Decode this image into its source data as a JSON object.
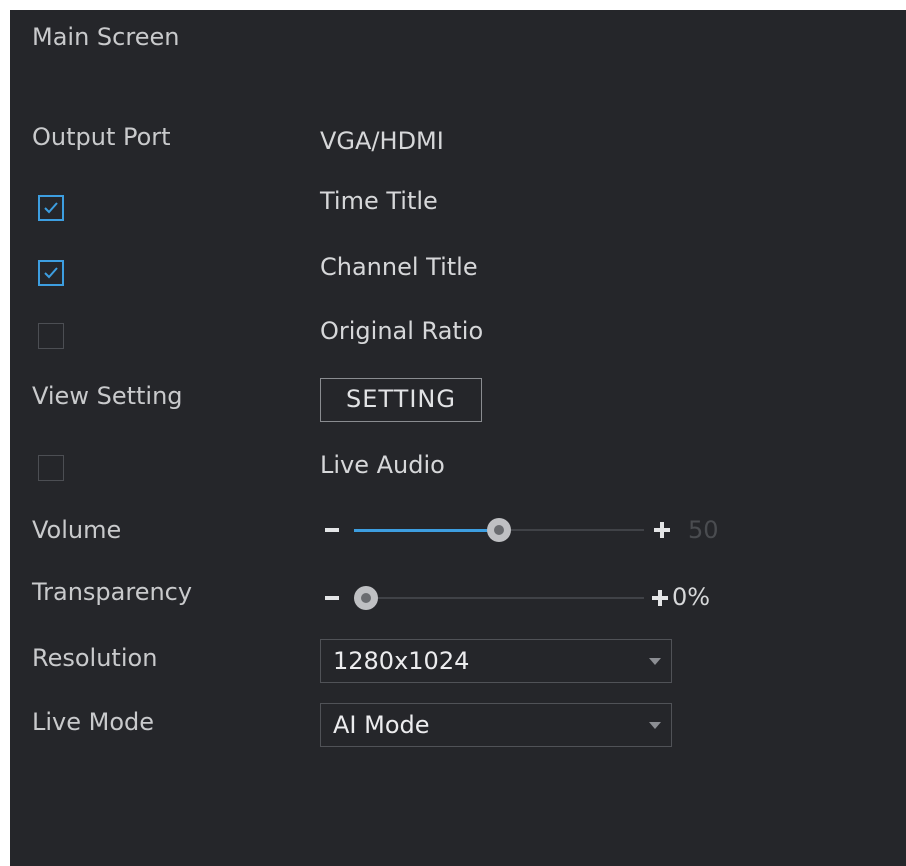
{
  "section_title": "Main Screen",
  "output_port": {
    "label": "Output Port",
    "value": "VGA/HDMI"
  },
  "time_title": {
    "label": "Time Title",
    "checked": true
  },
  "channel_title": {
    "label": "Channel Title",
    "checked": true
  },
  "original_ratio": {
    "label": "Original Ratio",
    "checked": false
  },
  "view_setting": {
    "label": "View Setting",
    "button_label": "SETTING"
  },
  "live_audio": {
    "label": "Live Audio",
    "checked": false
  },
  "volume": {
    "label": "Volume",
    "value": 50,
    "display": "50",
    "min": 0,
    "max": 100
  },
  "transparency": {
    "label": "Transparency",
    "value": 0,
    "display": "0%",
    "min": 0,
    "max": 100
  },
  "resolution": {
    "label": "Resolution",
    "selected": "1280x1024"
  },
  "live_mode": {
    "label": "Live Mode",
    "selected": "AI Mode"
  },
  "colors": {
    "background": "#25262a",
    "accent": "#3d9ee0",
    "volume_value_text": "#4a4c50",
    "transparency_value_text": "#d6d7d9"
  },
  "icons": {
    "checkbox_checked": "checkmark-icon",
    "dropdown": "chevron-down-icon",
    "slider_decrease": "minus-icon",
    "slider_increase": "plus-icon"
  }
}
